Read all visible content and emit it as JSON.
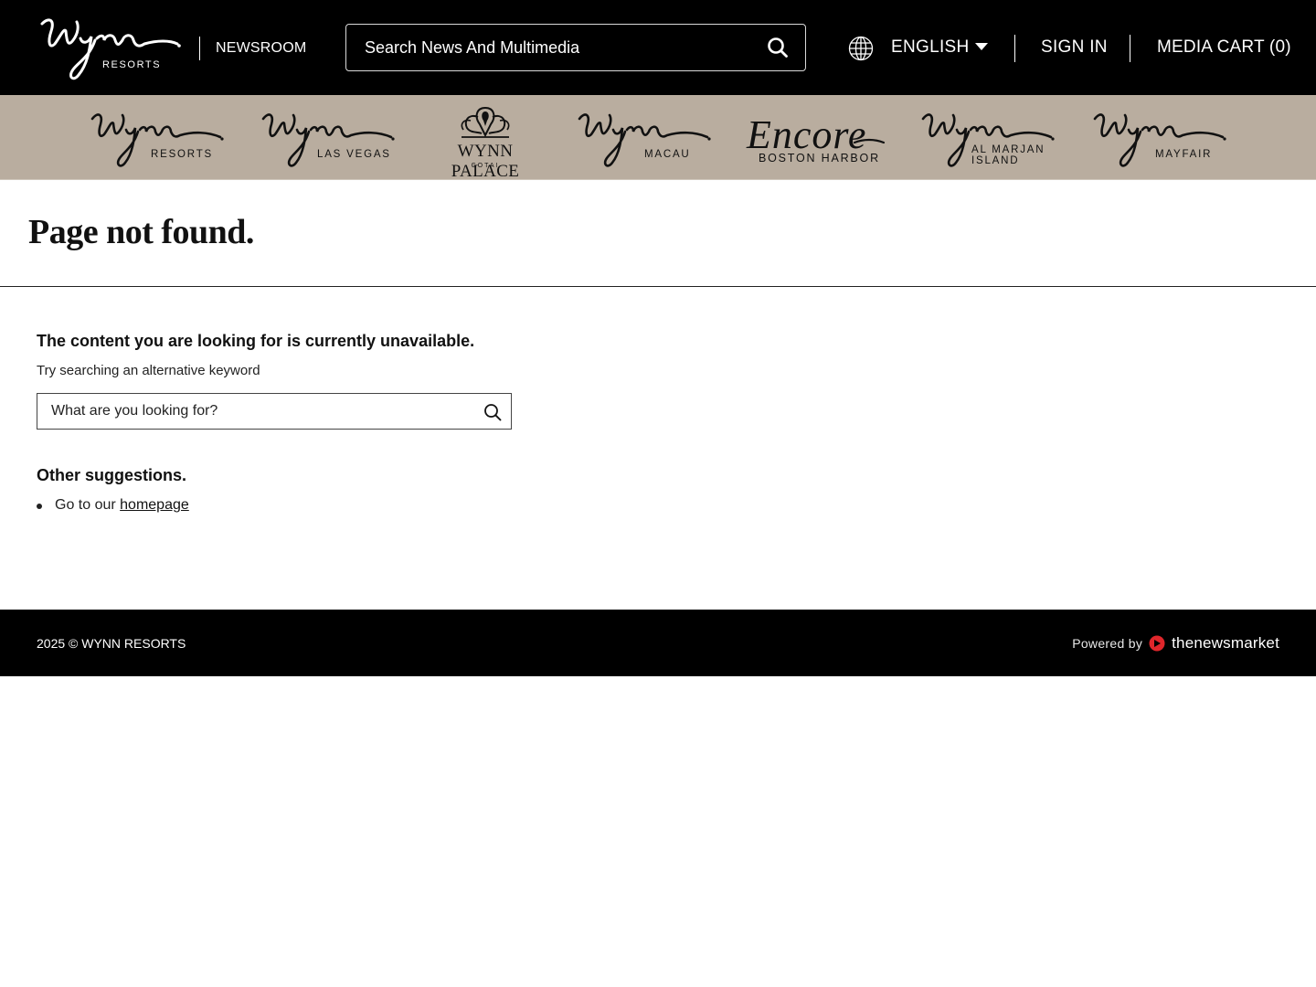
{
  "header": {
    "brand_name": "Wynn",
    "brand_sub": "RESORTS",
    "section": "NEWSROOM",
    "search_placeholder": "Search News And Multimedia",
    "language": "ENGLISH",
    "sign_in": "SIGN IN",
    "media_cart": "MEDIA CART (0)"
  },
  "brands": [
    {
      "wordmark": "Wynn",
      "sub": "RESORTS"
    },
    {
      "wordmark": "Wynn",
      "sub": "LAS VEGAS"
    },
    {
      "wordmark": "WYNN PALACE",
      "sub": "COTAI"
    },
    {
      "wordmark": "Wynn",
      "sub": "MACAU"
    },
    {
      "wordmark": "Encore",
      "sub": "BOSTON HARBOR"
    },
    {
      "wordmark": "Wynn",
      "sub": "AL MARJAN",
      "sub2": "ISLAND"
    },
    {
      "wordmark": "Wynn",
      "sub": "MAYFAIR"
    }
  ],
  "page": {
    "title": "Page not found.",
    "message": "The content you are looking for is currently unavailable.",
    "hint": "Try searching an alternative keyword",
    "search_placeholder": "What are you looking for?",
    "suggestions_title": "Other suggestions.",
    "suggestion_prefix": "Go to our",
    "suggestion_link": "homepage"
  },
  "footer": {
    "copyright": "2025 © WYNN RESORTS",
    "powered_by": "Powered by",
    "provider": "thenewsmarket"
  },
  "colors": {
    "header_bg": "#000000",
    "strip_bg": "#b9ad9f",
    "provider_accent": "#e0262b"
  }
}
